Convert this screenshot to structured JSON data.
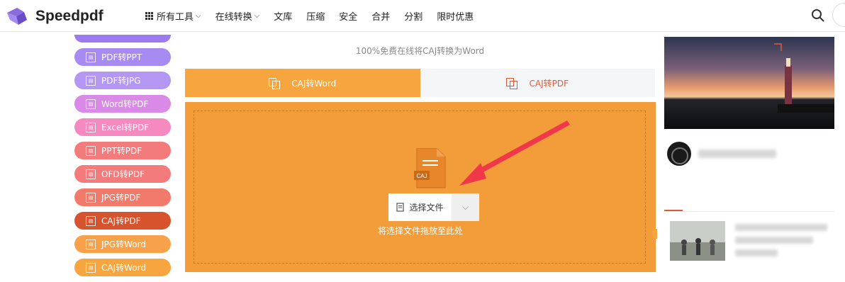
{
  "header": {
    "logo_text": "Speedpdf",
    "nav": [
      {
        "label": "所有工具",
        "has_grid": true,
        "has_chevron": true
      },
      {
        "label": "在线转换",
        "has_grid": false,
        "has_chevron": true
      },
      {
        "label": "文库",
        "has_grid": false,
        "has_chevron": false
      },
      {
        "label": "压缩",
        "has_grid": false,
        "has_chevron": false
      },
      {
        "label": "安全",
        "has_grid": false,
        "has_chevron": false
      },
      {
        "label": "合并",
        "has_grid": false,
        "has_chevron": false
      },
      {
        "label": "分割",
        "has_grid": false,
        "has_chevron": false
      },
      {
        "label": "限时优惠",
        "has_grid": false,
        "has_chevron": false
      }
    ],
    "search_icon": "search-icon",
    "brand_color": "#7b5cd6"
  },
  "sidebar": {
    "items": [
      {
        "label": "",
        "color": "#9b7bf0"
      },
      {
        "label": "PDF转PPT",
        "color": "#a88bf2"
      },
      {
        "label": "PDF转JPG",
        "color": "#b497f3"
      },
      {
        "label": "Word转PDF",
        "color": "#d88ae6"
      },
      {
        "label": "Excel转PDF",
        "color": "#f58ac0"
      },
      {
        "label": "PPT转PDF",
        "color": "#f47b7b"
      },
      {
        "label": "OFD转PDF",
        "color": "#f47b7b"
      },
      {
        "label": "JPG转PDF",
        "color": "#f27a6a"
      },
      {
        "label": "CAJ转PDF",
        "color": "#d6532e"
      },
      {
        "label": "JPG转Word",
        "color": "#f7a24a"
      },
      {
        "label": "CAJ转Word",
        "color": "#f7a53e"
      }
    ]
  },
  "main": {
    "subtitle": "100%免费在线将CAJ转换为Word",
    "tabs": [
      {
        "label": "CAJ转Word",
        "active": true
      },
      {
        "label": "CAJ转PDF",
        "active": false
      }
    ],
    "file_badge": "CAJ",
    "choose_button": "选择文件",
    "drop_hint": "将选择文件拖放至此处",
    "accent_color": "#f7a53e",
    "upload_bg": "#f29d39",
    "arrow_color": "#f0384a"
  }
}
